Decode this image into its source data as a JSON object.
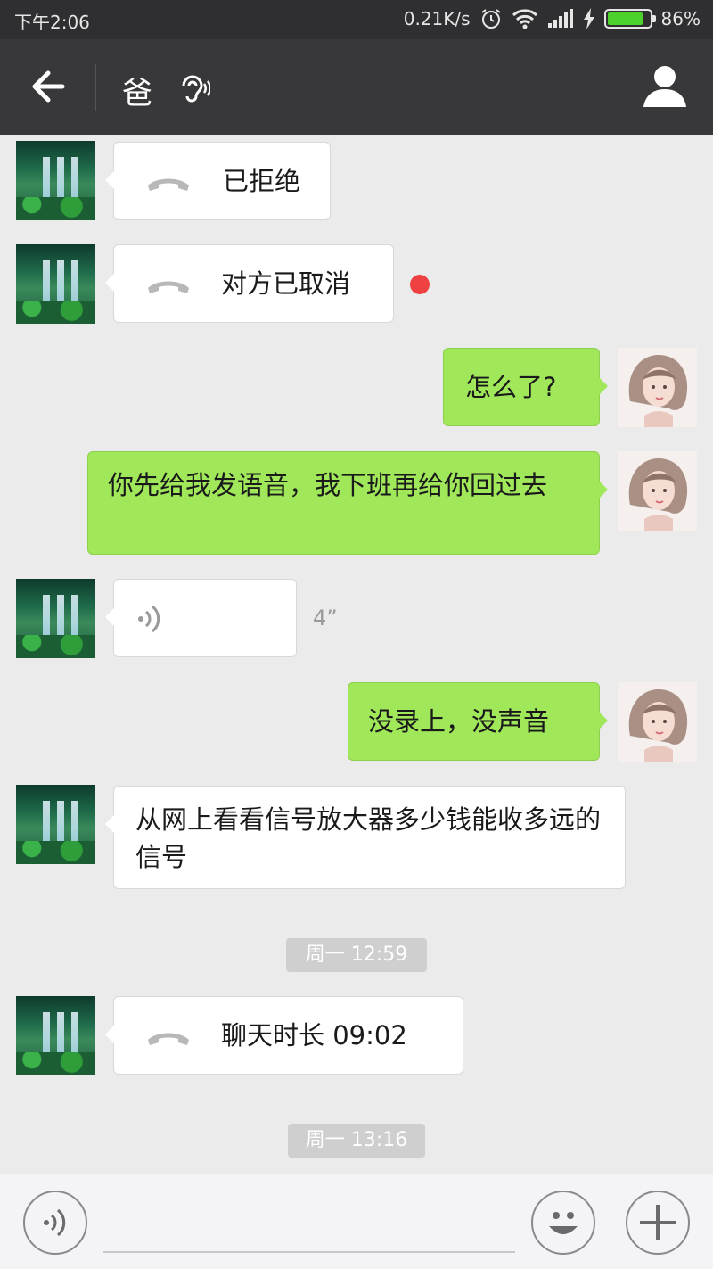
{
  "status_bar": {
    "time": "下午2:06",
    "net_speed": "0.21K/s",
    "battery": "86%"
  },
  "header": {
    "title": "爸"
  },
  "messages": {
    "m1": {
      "text": "已拒绝"
    },
    "m2": {
      "text": "对方已取消"
    },
    "m3": {
      "text": "怎么了?"
    },
    "m4": {
      "text": "你先给我发语音，我下班再给你回过去"
    },
    "m5": {
      "duration": "4”"
    },
    "m6": {
      "text": "没录上，没声音"
    },
    "m7": {
      "text": "从网上看看信号放大器多少钱能收多远的信号"
    },
    "t1": {
      "text": "周一 12:59"
    },
    "m8": {
      "text": "聊天时长 09:02"
    },
    "t2": {
      "text": "周一 13:16"
    }
  },
  "icons": {
    "back": "back-arrow-icon",
    "ear": "ear-icon",
    "profile": "person-icon",
    "phone": "phone-icon",
    "voice": "voice-wave-icon",
    "emoji": "smiley-icon",
    "plus": "plus-icon"
  },
  "colors": {
    "sent_bubble": "#a0e75a",
    "received_bubble": "#ffffff",
    "unread_dot": "#f04142",
    "header_bg": "#38383a"
  }
}
